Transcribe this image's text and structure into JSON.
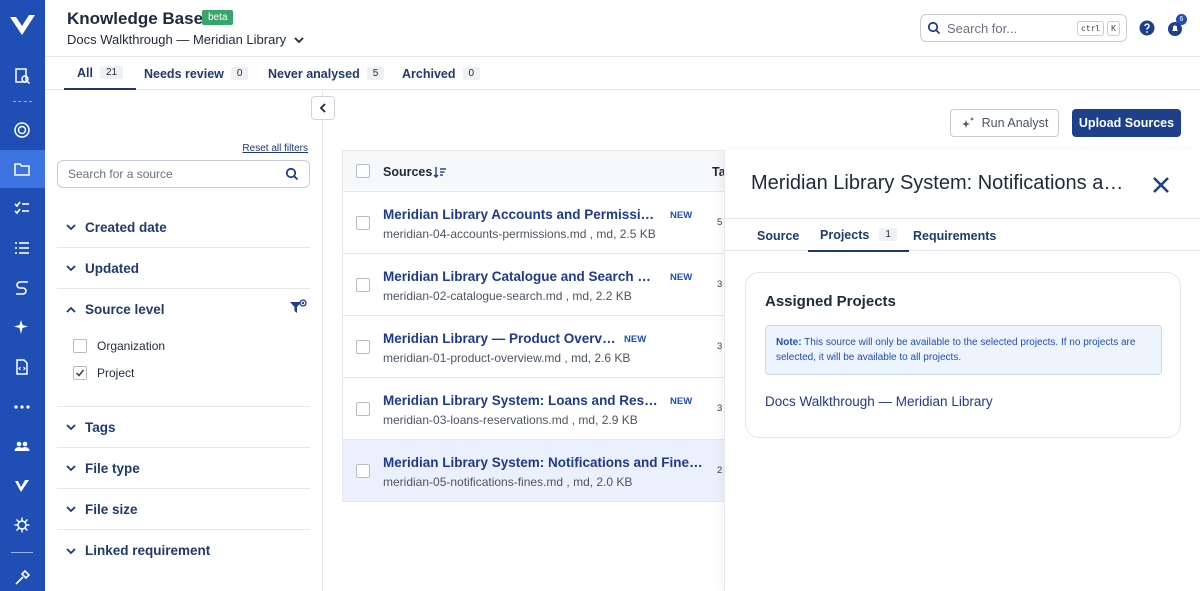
{
  "header": {
    "title": "Knowledge Base",
    "badge": "beta",
    "project": "Docs Walkthrough — Meridian Library",
    "search_placeholder": "Search for...",
    "shortcut_keys": [
      "ctrl",
      "K"
    ],
    "notification_count": "6"
  },
  "tabs": [
    {
      "label": "All",
      "count": "21"
    },
    {
      "label": "Needs review",
      "count": "0"
    },
    {
      "label": "Never analysed",
      "count": "5"
    },
    {
      "label": "Archived",
      "count": "0"
    }
  ],
  "filters": {
    "reset_label": "Reset all filters",
    "search_placeholder": "Search for a source",
    "groups": [
      "Created date",
      "Updated",
      "Source level",
      "Tags",
      "File type",
      "File size",
      "Linked requirement"
    ],
    "source_level_options": [
      {
        "label": "Organization",
        "checked": false
      },
      {
        "label": "Project",
        "checked": true
      }
    ]
  },
  "actions": {
    "run_analyst": "Run Analyst",
    "upload_sources": "Upload Sources"
  },
  "table": {
    "col_sources": "Sources",
    "col_tags": "Ta",
    "rows": [
      {
        "title": "Meridian Library Accounts and Permission…",
        "subtitle": "meridian-04-accounts-permissions.md , md, 2.5 KB",
        "badge": "NEW",
        "tag": "5"
      },
      {
        "title": "Meridian Library Catalogue and Search Fu…",
        "subtitle": "meridian-02-catalogue-search.md , md, 2.2 KB",
        "badge": "NEW",
        "tag": "3"
      },
      {
        "title": "Meridian Library — Product Overview",
        "subtitle": "meridian-01-product-overview.md , md, 2.6 KB",
        "badge": "NEW",
        "tag": "3"
      },
      {
        "title": "Meridian Library System: Loans and Reser…",
        "subtitle": "meridian-03-loans-reservations.md , md, 2.9 KB",
        "badge": "NEW",
        "tag": "3"
      },
      {
        "title": "Meridian Library System: Notifications and Fines …",
        "subtitle": "meridian-05-notifications-fines.md , md, 2.0 KB",
        "badge": "",
        "tag": "2"
      }
    ]
  },
  "detail": {
    "title": "Meridian Library System: Notifications a…",
    "tabs": [
      {
        "label": "Source",
        "count": ""
      },
      {
        "label": "Projects",
        "count": "1"
      },
      {
        "label": "Requirements",
        "count": ""
      }
    ],
    "card_title": "Assigned Projects",
    "note_label": "Note:",
    "note_text": " This source will only be available to the selected projects. If no projects are selected, it will be available to all projects.",
    "project_link": "Docs Walkthrough — Meridian Library"
  }
}
